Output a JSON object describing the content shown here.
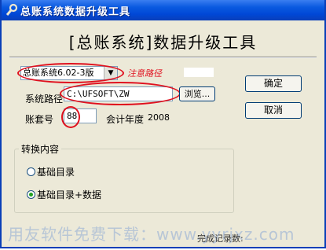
{
  "window": {
    "title": "总账系统数据升级工具"
  },
  "header": {
    "text": "[总账系统]数据升级工具"
  },
  "version_select": {
    "value": "总账系统6.02-3版"
  },
  "annotation": {
    "hint": "注意路径"
  },
  "path_field": {
    "label": "系统路径",
    "value": "C:\\UFSOFT\\ZW"
  },
  "browse_button": {
    "label": "浏览..."
  },
  "account_field": {
    "label": "账套号",
    "value": "88"
  },
  "fiscal_year": {
    "label": "会计年度",
    "value": "2008"
  },
  "buttons": {
    "ok": "确定",
    "cancel": "取消"
  },
  "convert_group": {
    "title": "转换内容",
    "options": [
      {
        "label": "基础目录",
        "selected": false
      },
      {
        "label": "基础目录+数据",
        "selected": true
      }
    ]
  },
  "watermark": "用友软件免费下载：www.yyrjxz.com",
  "status": "完成记录数:",
  "colors": {
    "titlebar": "#0047d6",
    "dialog_bg": "#ece9d8",
    "annotation": "#e0101e"
  }
}
